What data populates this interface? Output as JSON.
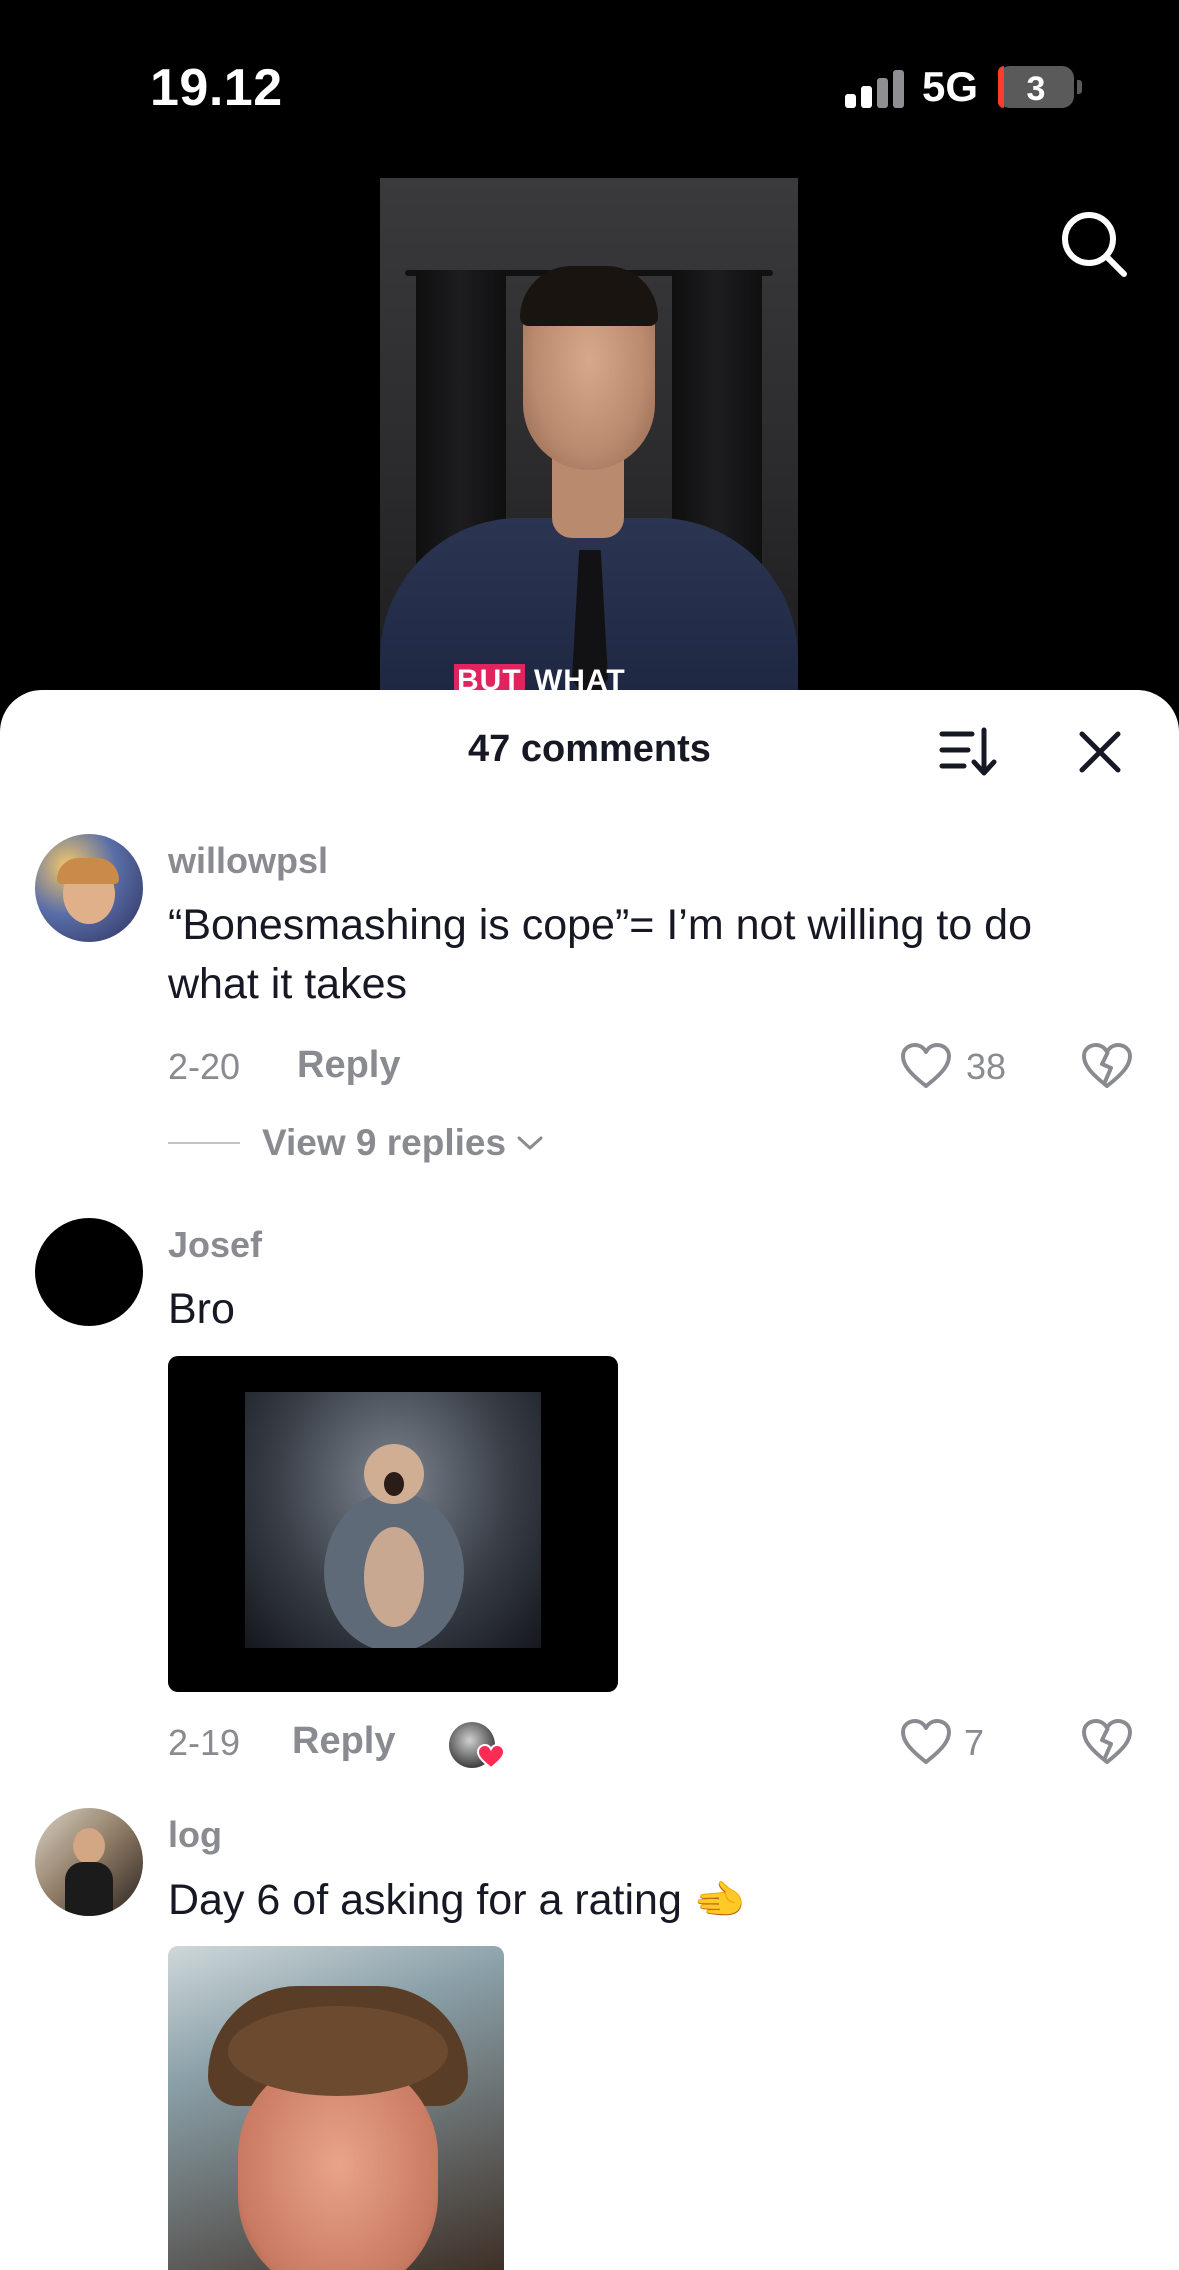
{
  "status_bar": {
    "time": "19.12",
    "network": "5G",
    "battery": "3"
  },
  "video": {
    "caption_highlight": "BUT",
    "caption_rest": " WHAT ACTUALLY"
  },
  "sheet": {
    "title": "47 comments"
  },
  "comments": [
    {
      "username": "willowpsl",
      "text": "“Bonesmashing is cope”= I’m not willing to do what it takes",
      "date": "2-20",
      "reply_label": "Reply",
      "likes": "38",
      "view_replies": "View 9 replies"
    },
    {
      "username": "Josef",
      "text": "Bro",
      "date": "2-19",
      "reply_label": "Reply",
      "likes": "7"
    },
    {
      "username": "log",
      "text": "Day 6 of asking for a rating",
      "emoji": "🫲"
    }
  ],
  "colors": {
    "accent_red": "#fe2c55",
    "muted_text": "#8a8b91",
    "primary_text": "#161823"
  },
  "icons": [
    "search-icon",
    "sort-icon",
    "close-icon",
    "heart-icon",
    "broken-heart-icon",
    "chevron-down-icon"
  ]
}
